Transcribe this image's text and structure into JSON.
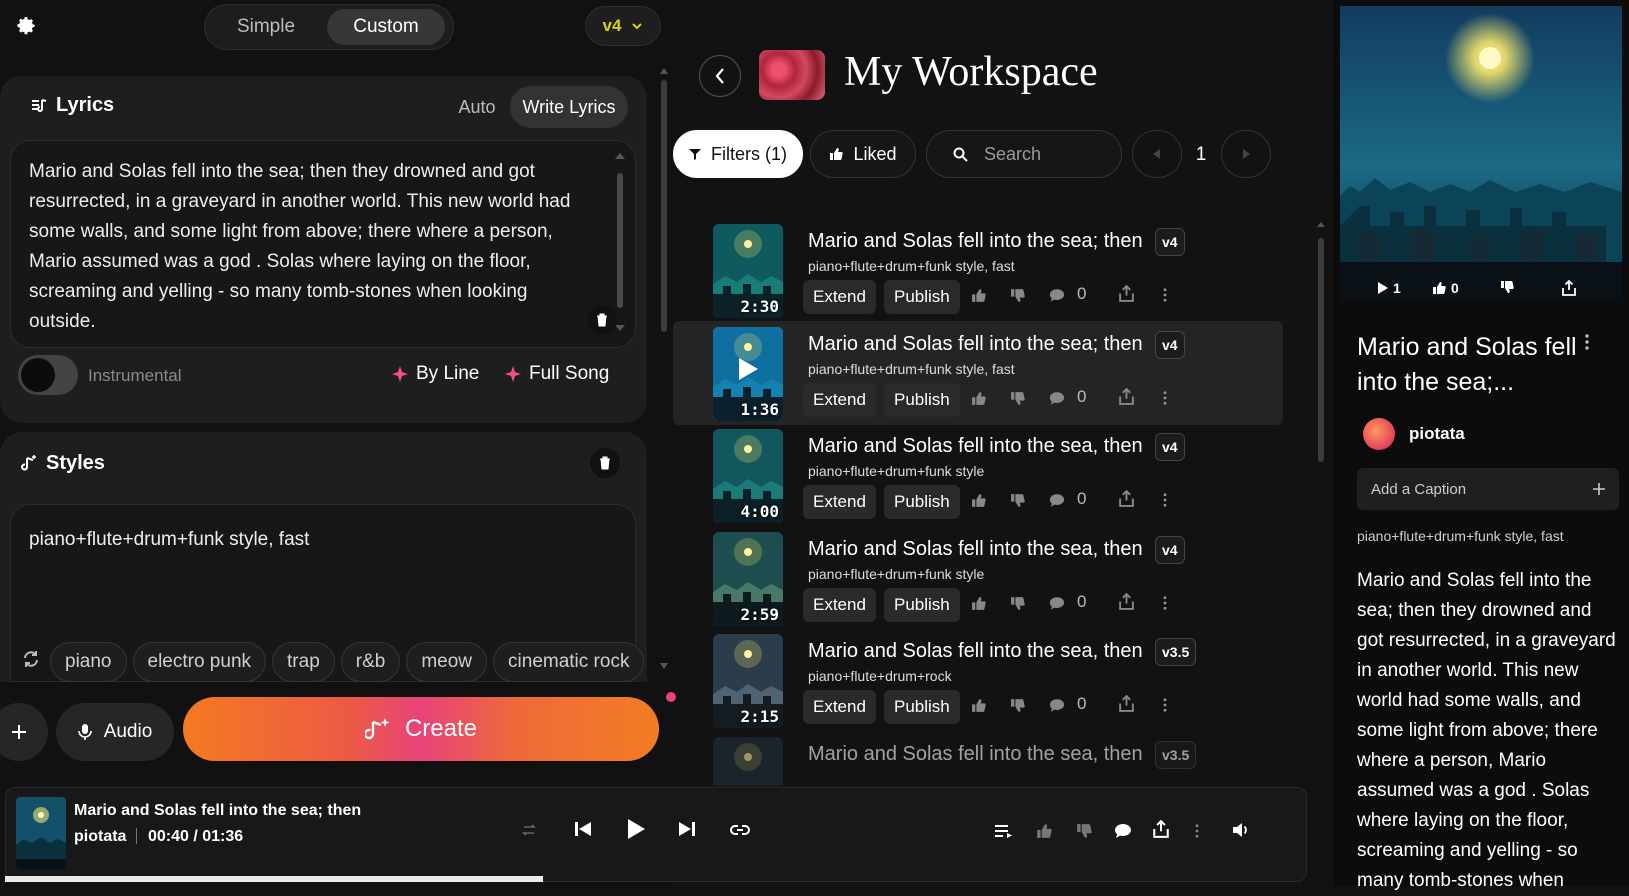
{
  "header": {
    "mode_simple": "Simple",
    "mode_custom": "Custom",
    "model_version": "v4"
  },
  "lyrics": {
    "title": "Lyrics",
    "mode_auto": "Auto",
    "mode_write": "Write Lyrics",
    "text": "Mario and Solas fell into the sea; then they drowned and got resurrected, in a graveyard in another world. This new world had some walls, and some light from above; there where a person, Mario assumed was a god . Solas where laying on the floor, screaming and yelling - so many tomb-stones when looking outside.",
    "instrumental_label": "Instrumental",
    "by_line": "By Line",
    "full_song": "Full Song"
  },
  "styles": {
    "title": "Styles",
    "value": "piano+flute+drum+funk style, fast",
    "chips": [
      "piano",
      "electro punk",
      "trap",
      "r&b",
      "meow",
      "cinematic rock"
    ]
  },
  "compose": {
    "audio_label": "Audio",
    "create_label": "Create"
  },
  "workspace": {
    "title": "My Workspace",
    "filters_label": "Filters (1)",
    "liked_label": "Liked",
    "search_placeholder": "Search",
    "page": "1",
    "extend_label": "Extend",
    "publish_label": "Publish",
    "songs": [
      {
        "title": "Mario and Solas fell into the sea; then",
        "version": "v4",
        "style": "piano+flute+drum+funk style, fast",
        "duration": "2:30",
        "comments": "0"
      },
      {
        "title": "Mario and Solas fell into the sea; then",
        "version": "v4",
        "style": "piano+flute+drum+funk style, fast",
        "duration": "1:36",
        "comments": "0"
      },
      {
        "title": "Mario and Solas fell into the sea, then",
        "version": "v4",
        "style": "piano+flute+drum+funk style",
        "duration": "4:00",
        "comments": "0"
      },
      {
        "title": "Mario and Solas fell into the sea, then",
        "version": "v4",
        "style": "piano+flute+drum+funk style",
        "duration": "2:59",
        "comments": "0"
      },
      {
        "title": "Mario and Solas fell into the sea, then",
        "version": "v3.5",
        "style": "piano+flute+drum+rock",
        "duration": "2:15",
        "comments": "0"
      },
      {
        "title": "Mario and Solas fell into the sea, then",
        "version": "v3.5",
        "style": "",
        "duration": "",
        "comments": ""
      }
    ]
  },
  "player": {
    "title": "Mario and Solas fell into the sea; then",
    "artist": "piotata",
    "time": "00:40 / 01:36",
    "progress_fraction": 0.417
  },
  "detail": {
    "plays": "1",
    "likes": "0",
    "title": "Mario and Solas fell into the sea;...",
    "artist": "piotata",
    "caption_placeholder": "Add a Caption",
    "style": "piano+flute+drum+funk style, fast",
    "lyrics": "Mario and Solas fell into the sea; then they drowned and got resurrected, in a graveyard in another world. This new world had some walls, and some light from above; there where a person, Mario assumed was a god . Solas where laying on the floor, screaming and yelling - so many tomb-stones when"
  },
  "colors": {
    "accent_version": "#d8d21a",
    "spark_pink": "#f0508a",
    "create_gradient_start": "#f47a22",
    "create_gradient_mid": "#e8437a"
  }
}
